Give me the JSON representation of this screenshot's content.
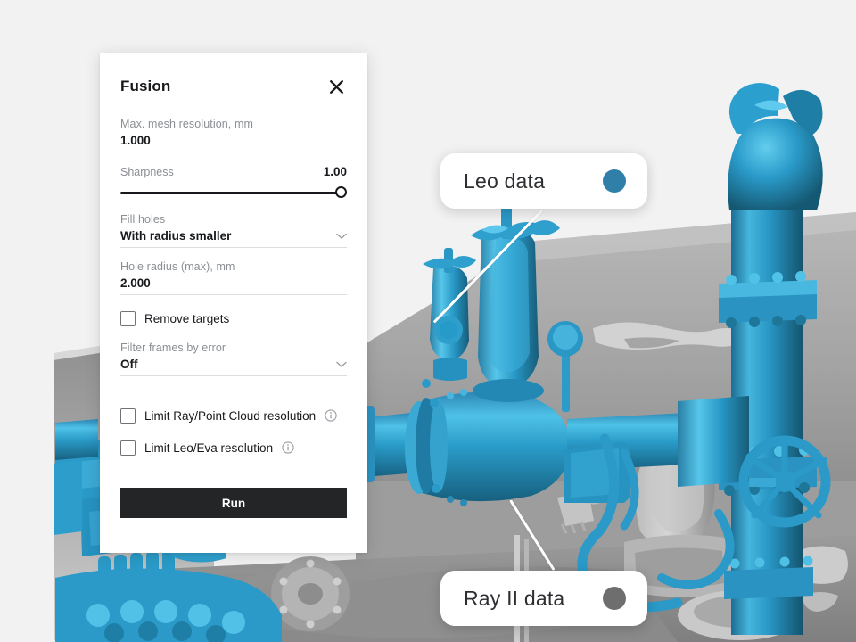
{
  "app": {
    "background_color": "#f2f2f2",
    "viewport_name": "3d-scan-viewport"
  },
  "panel": {
    "title": "Fusion",
    "close_icon": "close-icon",
    "fields": [
      {
        "label": "Max. mesh resolution, mm",
        "value": "1.000",
        "type": "number"
      },
      {
        "label": "Hole radius (max), mm",
        "value": "2.000",
        "type": "number"
      }
    ],
    "slider": {
      "label": "Sharpness",
      "value": "1.00",
      "percent": 100
    },
    "selects": [
      {
        "label": "Fill holes",
        "value": "With radius smaller",
        "chevron": "chevron-down-icon"
      },
      {
        "label": "Filter frames by error",
        "value": "Off",
        "chevron": "chevron-down-icon"
      }
    ],
    "checkboxes": [
      {
        "label": "Remove targets",
        "checked": false,
        "info": false
      },
      {
        "label": "Limit Ray/Point Cloud resolution",
        "checked": false,
        "info": true
      },
      {
        "label": "Limit Leo/Eva resolution",
        "checked": false,
        "info": true
      }
    ],
    "run_label": "Run",
    "run_color": "#232527"
  },
  "callouts": [
    {
      "label": "Leo data",
      "dot_color": "#2f7fa8",
      "name": "callout-leo-data"
    },
    {
      "label": "Ray II data",
      "dot_color": "#6e6e6e",
      "name": "callout-ray-ii-data"
    }
  ],
  "scene": {
    "leo_mesh_color": "#2196c4",
    "ray_mesh_color": "#9a9a9a",
    "description": "3D scan of industrial pipe assembly: blue Leo-scanned valves and piping over gray Ray II scanned wall and floor geometry"
  }
}
